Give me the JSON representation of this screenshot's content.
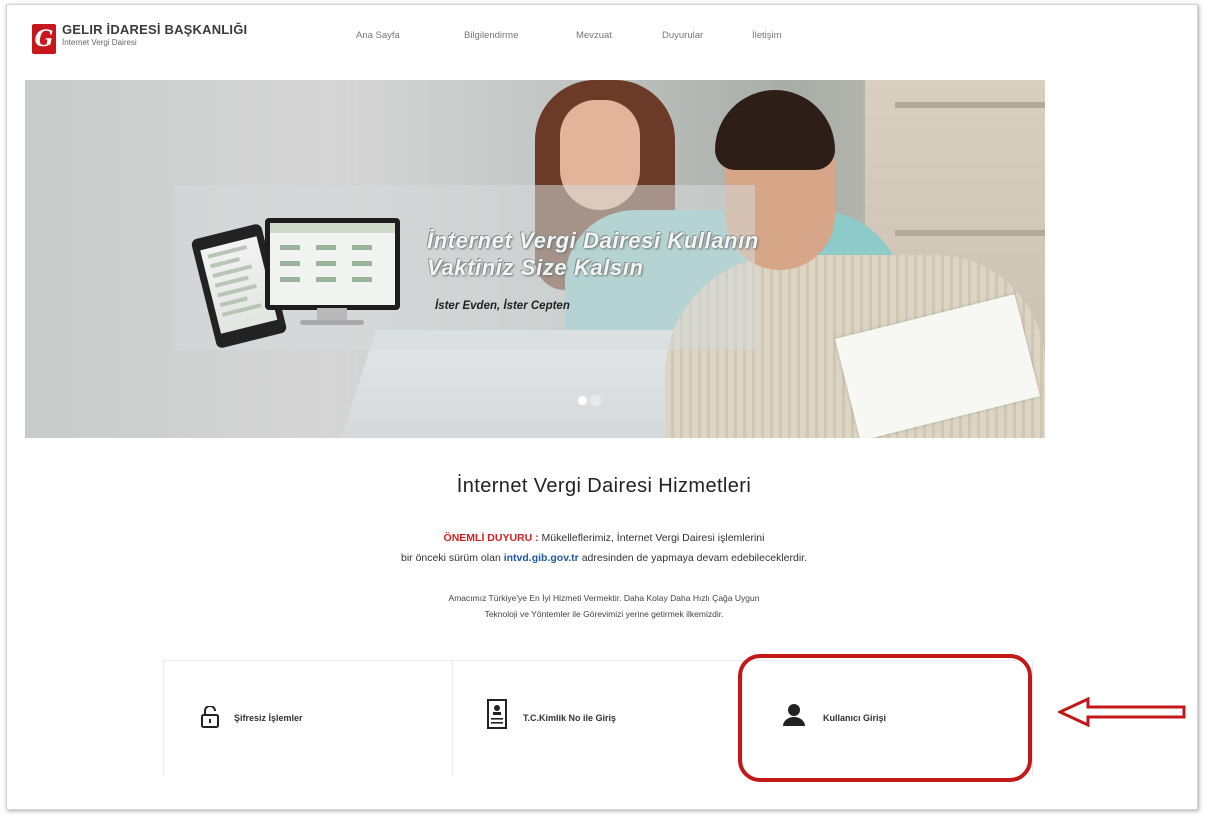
{
  "header": {
    "org_name": "GELIR İDARESİ BAŞKANLIĞI",
    "org_sub": "İnternet Vergi Dairesi",
    "logo_letter": "G"
  },
  "nav": {
    "items": [
      "Ana Sayfa",
      "Bilgilendirme",
      "Mevzuat",
      "Duyurular",
      "İletişim"
    ]
  },
  "banner": {
    "line1": "İnternet Vergi Dairesi Kullanın",
    "line2": "Vaktiniz Size Kalsın",
    "line3": "İster Evden, İster Cepten",
    "slide_count": 2,
    "active_slide": 1
  },
  "main": {
    "title": "İnternet Vergi Dairesi Hizmetleri",
    "notice_label": "ÖNEMLİ DUYURU :",
    "notice_text1": "Mükelleflerimiz, İnternet Vergi Dairesi işlemlerini",
    "notice_text2a": "bir önceki sürüm olan",
    "notice_link": "intvd.gib.gov.tr",
    "notice_text2b": "adresinden de yapmaya devam edebileceklerdir.",
    "motto1": "Amacımız Türkiye'ye En İyi Hizmeti Vermektir. Daha Kolay Daha Hızlı Çağa Uygun",
    "motto2": "Teknoloji ve Yöntemler ile Görevimizi yerine getirmek ilkemizdir."
  },
  "login": {
    "option1": "Şifresiz İşlemler",
    "option2": "T.C.Kimlik No ile Giriş",
    "option3": "Kullanıcı Girişi"
  },
  "colors": {
    "brand_red": "#c8161d",
    "annotation_red": "#c21818",
    "link_blue": "#1e5aa8"
  }
}
